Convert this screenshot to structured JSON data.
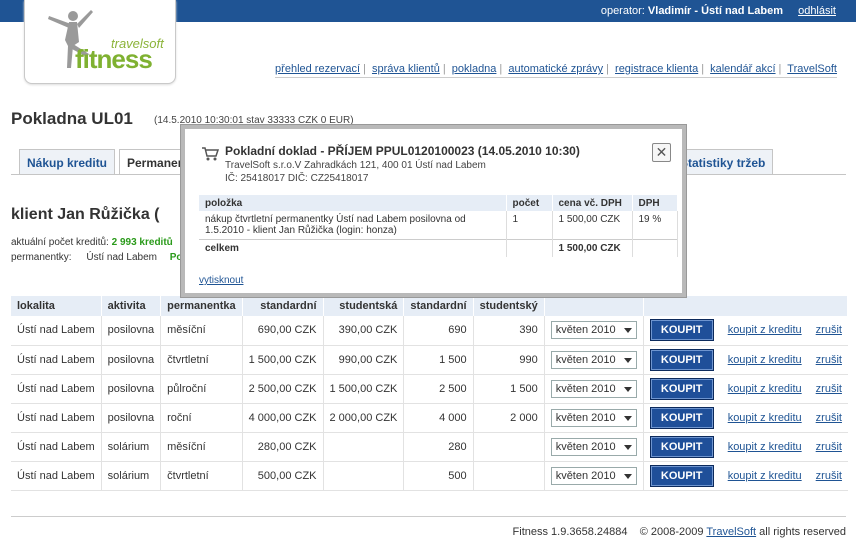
{
  "header": {
    "operator_label": "operator:",
    "operator_name": "Vladimír - Ústí nad Labem",
    "logout": "odhlásit"
  },
  "logo": {
    "brand_small": "travelsoft",
    "brand_big": "fitness"
  },
  "nav": [
    "přehled rezervací",
    "správa klientů",
    "pokladna",
    "automatické zprávy",
    "registrace klienta",
    "kalendář akcí",
    "TravelSoft"
  ],
  "page": {
    "title": "Pokladna UL01",
    "subtitle": "(14.5.2010 10:30:01 stav 33333 CZK 0 EUR)"
  },
  "tabs": [
    "Nákup kreditu",
    "Permanentky",
    "Statistiky tržeb"
  ],
  "client": {
    "heading": "klient Jan Růžička (",
    "credit_label": "aktuální počet kreditů:",
    "credit_value": "2 993 kreditů",
    "passes_label": "permanentky:",
    "passes_location": "Ústí nad Labem",
    "passes_status": "Po"
  },
  "table": {
    "headers": [
      "lokalita",
      "aktivita",
      "permanentka",
      "standardní",
      "studentská",
      "standardní",
      "studentský",
      "",
      ""
    ],
    "rows": [
      {
        "loc": "Ústí nad Labem",
        "act": "posilovna",
        "pass": "měsíční",
        "std": "690,00 CZK",
        "stu": "390,00 CZK",
        "cstd": "690",
        "cstu": "390",
        "month": "květen 2010"
      },
      {
        "loc": "Ústí nad Labem",
        "act": "posilovna",
        "pass": "čtvrtletní",
        "std": "1 500,00 CZK",
        "stu": "990,00 CZK",
        "cstd": "1 500",
        "cstu": "990",
        "month": "květen 2010"
      },
      {
        "loc": "Ústí nad Labem",
        "act": "posilovna",
        "pass": "půlroční",
        "std": "2 500,00 CZK",
        "stu": "1 500,00 CZK",
        "cstd": "2 500",
        "cstu": "1 500",
        "month": "květen 2010"
      },
      {
        "loc": "Ústí nad Labem",
        "act": "posilovna",
        "pass": "roční",
        "std": "4 000,00 CZK",
        "stu": "2 000,00 CZK",
        "cstd": "4 000",
        "cstu": "2 000",
        "month": "květen 2010"
      },
      {
        "loc": "Ústí nad Labem",
        "act": "solárium",
        "pass": "měsíční",
        "std": "280,00 CZK",
        "stu": "",
        "cstd": "280",
        "cstu": "",
        "month": "květen 2010"
      },
      {
        "loc": "Ústí nad Labem",
        "act": "solárium",
        "pass": "čtvrtletní",
        "std": "500,00 CZK",
        "stu": "",
        "cstd": "500",
        "cstu": "",
        "month": "květen 2010"
      }
    ],
    "buy_label": "KOUPIT",
    "buy_credit_label": "koupit z kreditu",
    "cancel_label": "zrušit"
  },
  "modal": {
    "title": "Pokladní doklad - PŘÍJEM PPUL0120100023 (14.05.2010 10:30)",
    "address": "TravelSoft s.r.o.V Zahradkách 121, 400 01 Ústí nad Labem",
    "ids": "IČ: 25418017   DIČ: CZ25418017",
    "close": "✕",
    "headers": [
      "položka",
      "počet",
      "cena vč. DPH",
      "DPH"
    ],
    "item_line1": "nákup čtvrtletní permanentky Ústí nad Labem posilovna od",
    "item_line2": "1.5.2010 - klient Jan Růžička (login: honza)",
    "item_count": "1",
    "item_price": "1 500,00 CZK",
    "item_vat": "19 %",
    "total_label": "celkem",
    "total_value": "1 500,00 CZK",
    "print": "vytisknout"
  },
  "footer": {
    "version": "Fitness 1.9.3658.24884",
    "copy": "© 2008-2009",
    "company": "TravelSoft",
    "rights": "all rights reserved"
  }
}
